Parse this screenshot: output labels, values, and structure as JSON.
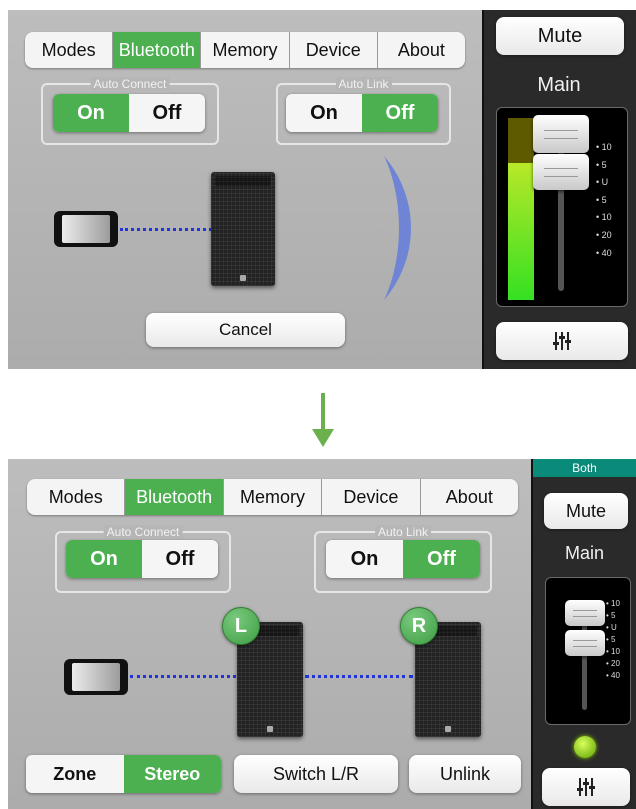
{
  "tabs": [
    "Modes",
    "Bluetooth",
    "Memory",
    "Device",
    "About"
  ],
  "active_tab": "Bluetooth",
  "auto_connect": {
    "label": "Auto Connect",
    "on": "On",
    "off": "Off",
    "selected": "On"
  },
  "auto_link": {
    "label": "Auto Link",
    "on": "On",
    "off": "Off",
    "selected": "Off"
  },
  "top": {
    "cancel": "Cancel"
  },
  "bottom": {
    "badge_left": "L",
    "badge_right": "R",
    "zone": "Zone",
    "stereo": "Stereo",
    "selected_mode": "Stereo",
    "switch_lr": "Switch L/R",
    "unlink": "Unlink",
    "both_tab": "Both"
  },
  "side": {
    "mute": "Mute",
    "main": "Main",
    "scale_labels": [
      "• 10",
      "• 5",
      "• U",
      "• 5",
      "• 10",
      "• 20",
      "• 40"
    ],
    "mixer_icon": "mixer-sliders-icon"
  },
  "colors": {
    "accent_green": "#4caf50",
    "link_blue": "#2233dd",
    "teal": "#0a8a78",
    "meter_green": "#35e022"
  }
}
